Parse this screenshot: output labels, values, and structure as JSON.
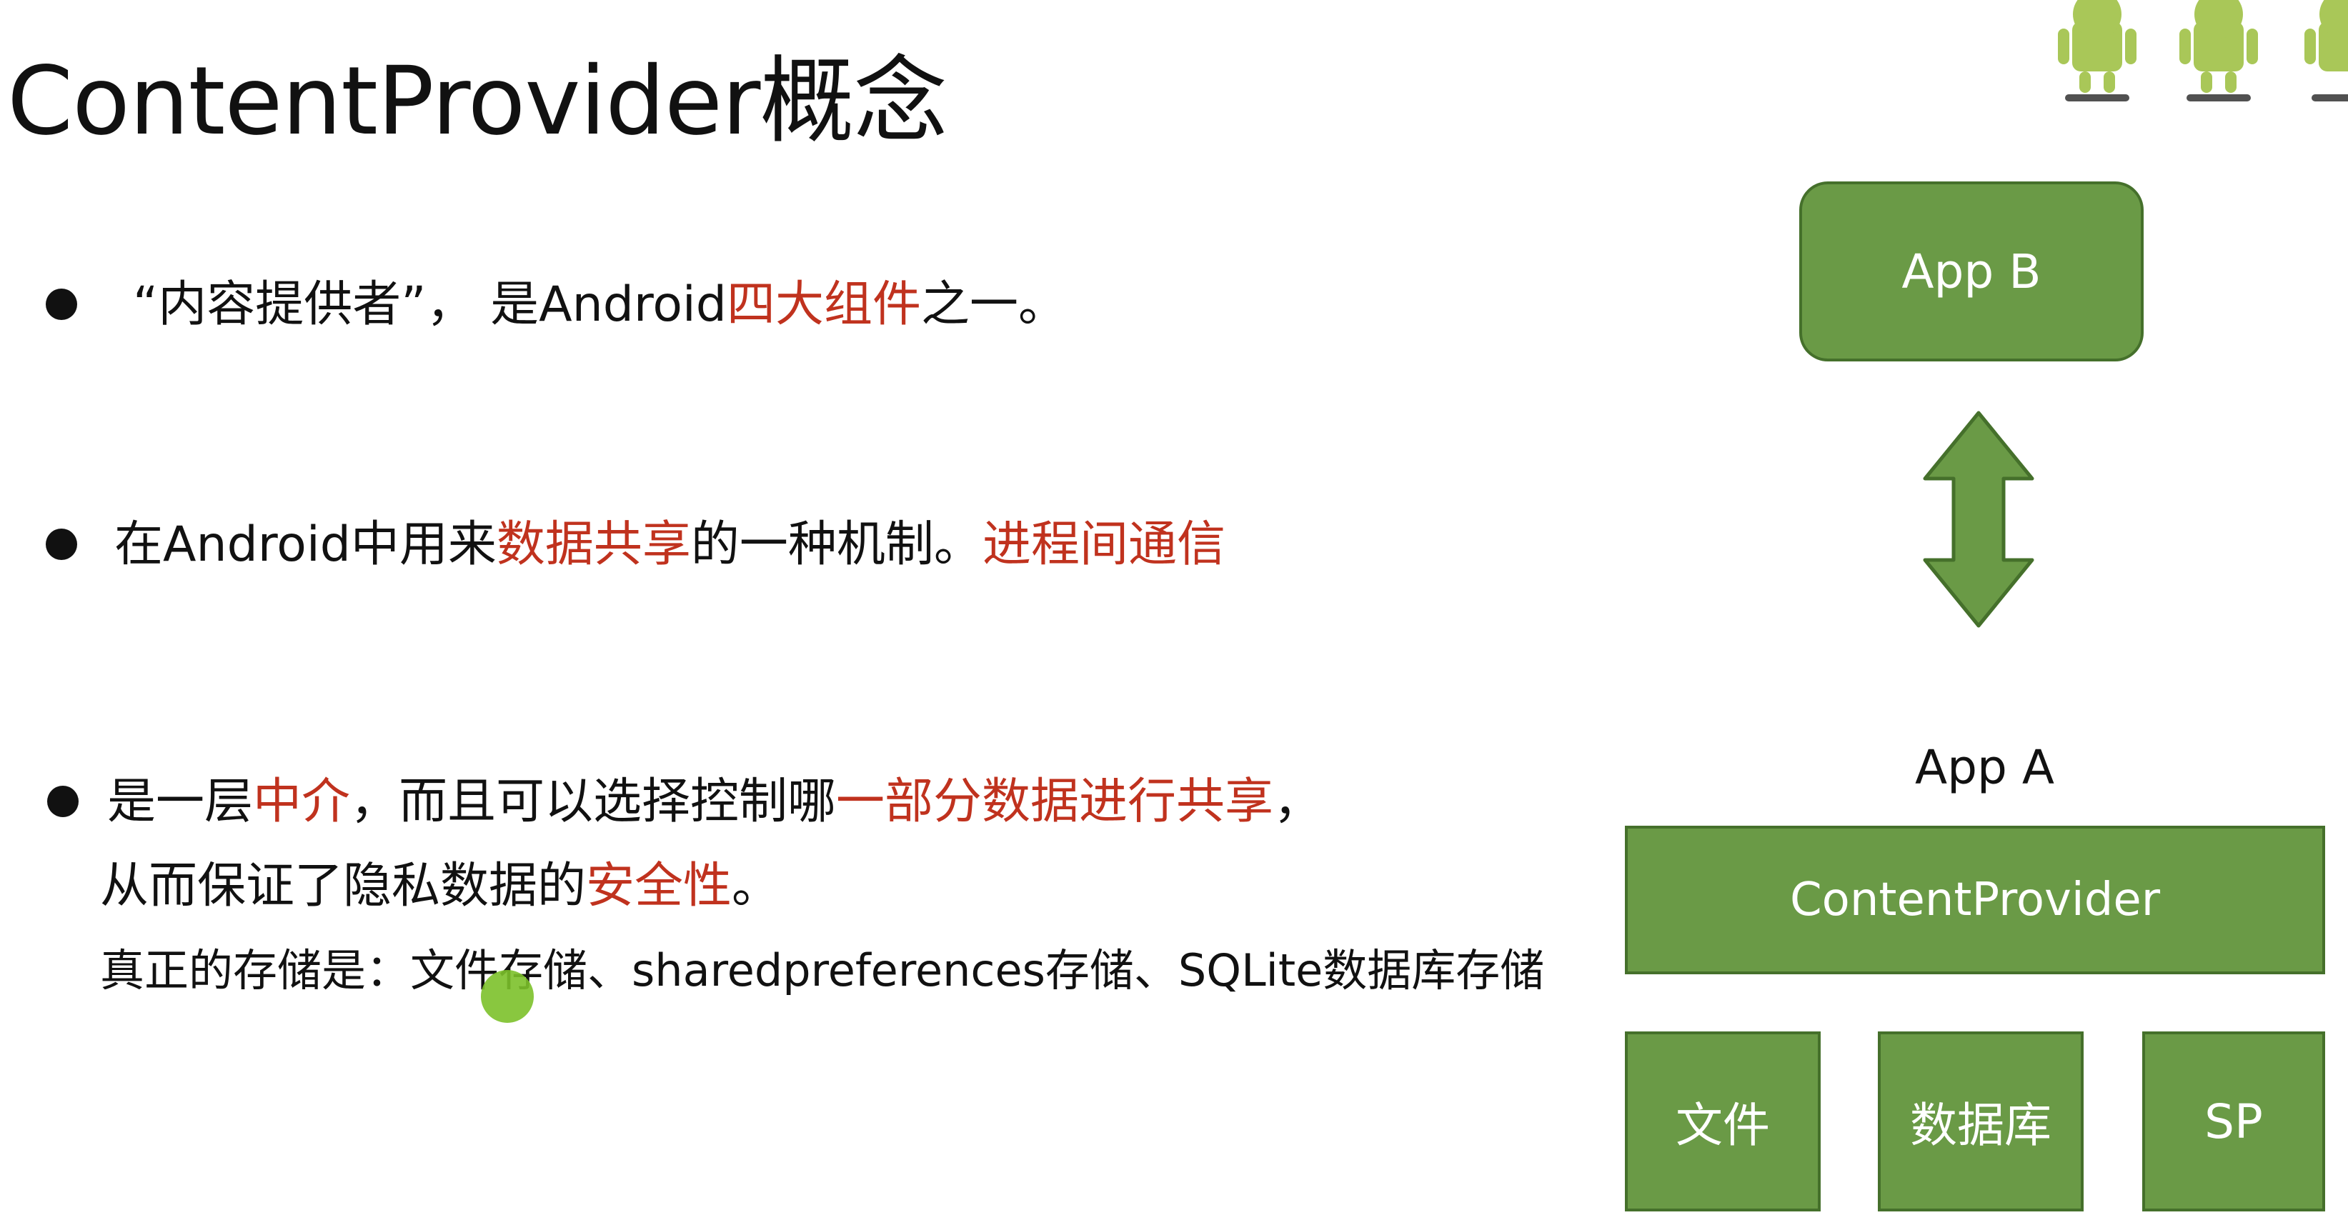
{
  "title": "ContentProvider概念",
  "bullets": [
    {
      "line1": [
        {
          "t": "“内容提供者”，  是Android",
          "red": false
        },
        {
          "t": "四大组件",
          "red": true
        },
        {
          "t": "之一。",
          "red": false
        }
      ]
    },
    {
      "line1": [
        {
          "t": "在Android中用来",
          "red": false
        },
        {
          "t": "数据共享",
          "red": true
        },
        {
          "t": "的一种机制。",
          "red": false
        },
        {
          "t": "进程间通信",
          "red": true
        }
      ]
    },
    {
      "line1": [
        {
          "t": "是一层",
          "red": false
        },
        {
          "t": "中介",
          "red": true
        },
        {
          "t": "，而且可以选择控制哪",
          "red": false
        },
        {
          "t": "一部分数据进行共享",
          "red": true
        },
        {
          "t": "，",
          "red": false
        }
      ],
      "line2": [
        {
          "t": "从而保证了隐私数据的",
          "red": false
        },
        {
          "t": "安全性",
          "red": true
        },
        {
          "t": "。",
          "red": false
        }
      ],
      "line3": [
        {
          "t": "真正的存储是：文件存储、sharedpreferences存储、SQLite数据库存储",
          "red": false
        }
      ]
    }
  ],
  "diagram": {
    "app_b": "App B",
    "app_a": "App A",
    "content_provider": "ContentProvider",
    "storage": [
      "文件",
      "数据库",
      "SP"
    ]
  },
  "colors": {
    "box_fill": "#6a9a46",
    "box_border": "#45702b",
    "highlight_red": "#c0321e"
  },
  "icons": [
    "android-robot-icon",
    "double-arrow-icon",
    "cursor-icon"
  ]
}
